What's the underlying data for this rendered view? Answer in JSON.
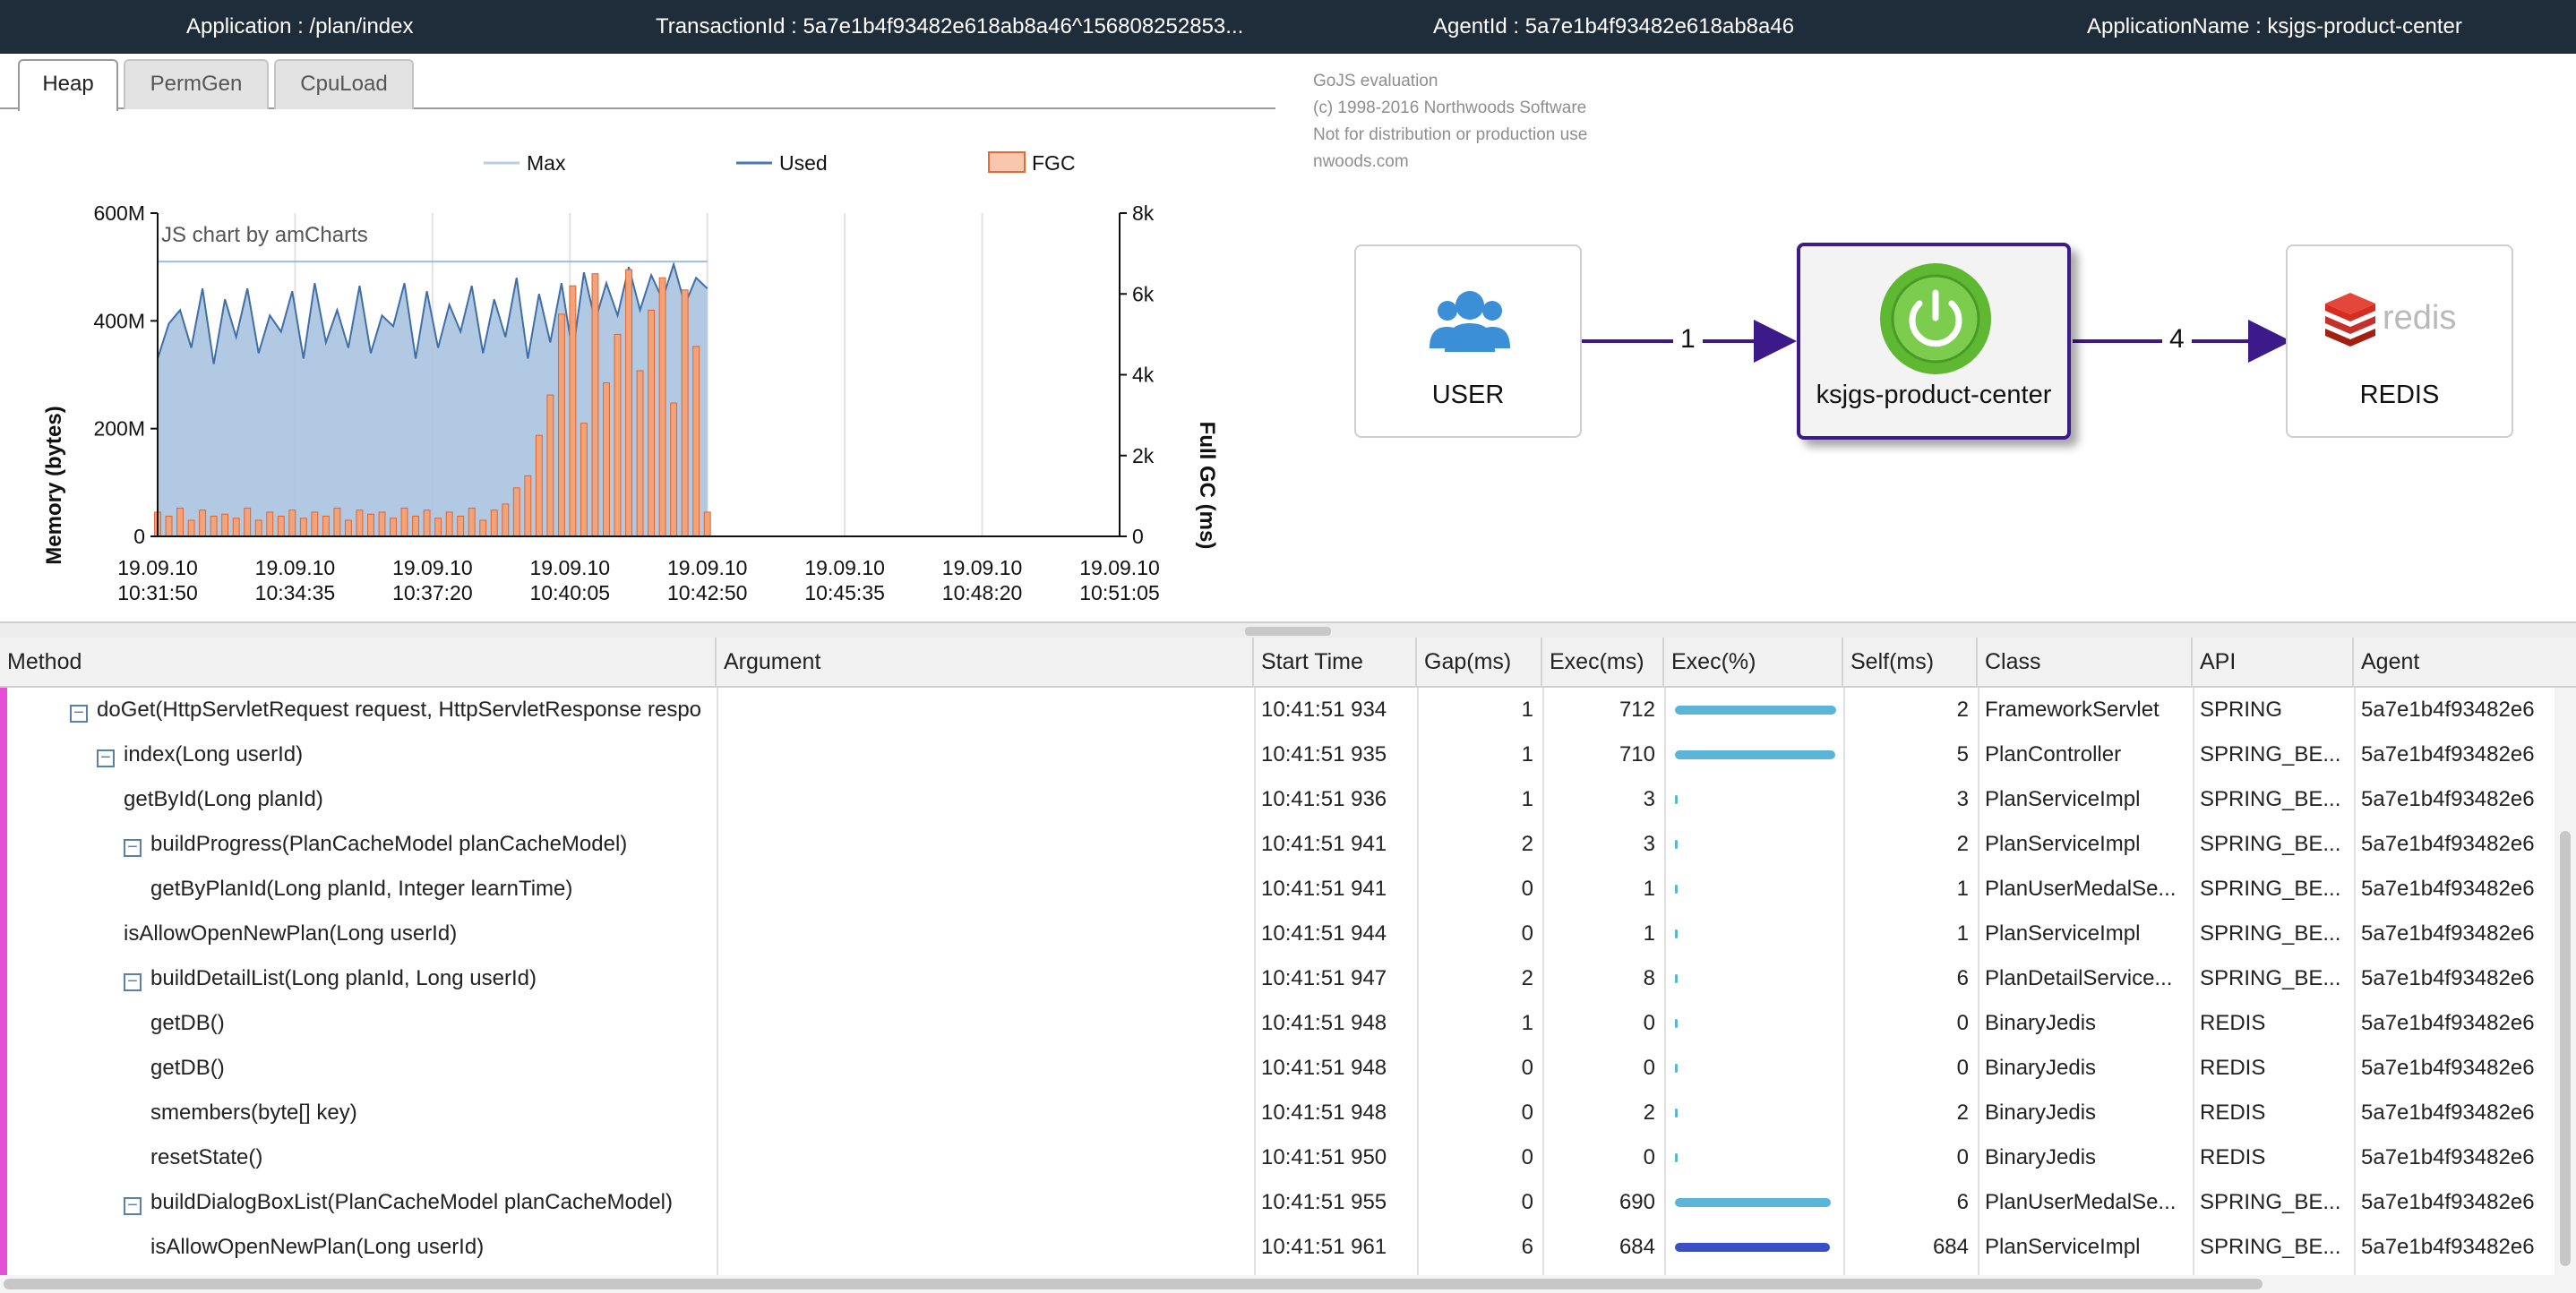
{
  "topbar": {
    "application": "Application : /plan/index",
    "transaction_id": "TransactionId : 5a7e1b4f93482e618ab8a46^156808252853...",
    "agent_id": "AgentId : 5a7e1b4f93482e618ab8a46",
    "application_name": "ApplicationName : ksjgs-product-center"
  },
  "tabs": [
    {
      "label": "Heap",
      "active": true
    },
    {
      "label": "PermGen",
      "active": false
    },
    {
      "label": "CpuLoad",
      "active": false
    }
  ],
  "chart_data": {
    "type": "area",
    "watermark": "JS chart by amCharts",
    "legend": [
      {
        "name": "Max",
        "color": "#b8cfe6",
        "kind": "line"
      },
      {
        "name": "Used",
        "color": "#4a7ab0",
        "kind": "line"
      },
      {
        "name": "FGC",
        "color": "#f8c7ad",
        "kind": "box"
      }
    ],
    "legend_position": "top",
    "ylabel_left": "Memory (bytes)",
    "ylabel_right": "Full GC (ms)",
    "y_left_ticks": [
      "0",
      "200M",
      "400M",
      "600M"
    ],
    "y_left_range_mb": [
      0,
      600
    ],
    "y_right_ticks": [
      "0",
      "2k",
      "4k",
      "6k",
      "8k"
    ],
    "y_right_range_ms": [
      0,
      8000
    ],
    "x_ticks": [
      {
        "date": "19.09.10",
        "time": "10:31:50"
      },
      {
        "date": "19.09.10",
        "time": "10:34:35"
      },
      {
        "date": "19.09.10",
        "time": "10:37:20"
      },
      {
        "date": "19.09.10",
        "time": "10:40:05"
      },
      {
        "date": "19.09.10",
        "time": "10:42:50"
      },
      {
        "date": "19.09.10",
        "time": "10:45:35"
      },
      {
        "date": "19.09.10",
        "time": "10:48:20"
      },
      {
        "date": "19.09.10",
        "time": "10:51:05"
      }
    ],
    "x_range": [
      "10:31:50",
      "10:51:05"
    ],
    "data_end": "10:42:50",
    "max_mb": 510,
    "grid": true,
    "series": [
      {
        "name": "Used",
        "unit": "MB",
        "values": [
          330,
          395,
          420,
          350,
          460,
          320,
          440,
          370,
          460,
          340,
          410,
          380,
          455,
          330,
          470,
          360,
          420,
          350,
          465,
          340,
          410,
          390,
          470,
          330,
          455,
          350,
          430,
          380,
          465,
          340,
          440,
          370,
          480,
          330,
          450,
          360,
          470,
          340,
          490,
          400,
          470,
          410,
          500,
          420,
          485,
          440,
          505,
          430,
          480,
          460
        ]
      },
      {
        "name": "FGC",
        "unit": "ms",
        "values": [
          600,
          500,
          700,
          400,
          650,
          500,
          550,
          450,
          700,
          400,
          600,
          500,
          650,
          450,
          600,
          500,
          700,
          400,
          650,
          550,
          600,
          450,
          700,
          500,
          650,
          450,
          600,
          500,
          700,
          400,
          650,
          800,
          1200,
          1500,
          2500,
          3500,
          5500,
          6200,
          2800,
          6500,
          3800,
          5000,
          6600,
          4100,
          5600,
          6400,
          3300,
          6100,
          4700,
          600
        ]
      }
    ]
  },
  "diagram": {
    "watermark": [
      "GoJS evaluation",
      "(c) 1998-2016 Northwoods Software",
      "Not for distribution or production use",
      "nwoods.com"
    ],
    "nodes": [
      {
        "label": "USER",
        "icon": "users-icon"
      },
      {
        "label": "ksjgs-product-center",
        "icon": "spring-power-icon"
      },
      {
        "label": "REDIS",
        "icon": "redis-logo"
      }
    ],
    "redis_logo_text": "redis",
    "links": [
      {
        "label": "1"
      },
      {
        "label": "4"
      }
    ]
  },
  "table": {
    "columns": [
      "Method",
      "Argument",
      "Start Time",
      "Gap(ms)",
      "Exec(ms)",
      "Exec(%)",
      "Self(ms)",
      "Class",
      "API",
      "Agent"
    ],
    "rows": [
      {
        "method": "doGet(HttpServletRequest request, HttpServletResponse respo",
        "level": 0,
        "toggle": true,
        "argument": "",
        "start": "10:41:51 934",
        "gap": "1",
        "exec": "712",
        "pct": 100,
        "self": "2",
        "class": "FrameworkServlet",
        "api": "SPRING",
        "agent": "5a7e1b4f93482e6",
        "bar_color": "#5bb5d9"
      },
      {
        "method": "index(Long userId)",
        "level": 1,
        "toggle": true,
        "argument": "",
        "start": "10:41:51 935",
        "gap": "1",
        "exec": "710",
        "pct": 99.7,
        "self": "5",
        "class": "PlanController",
        "api": "SPRING_BE...",
        "agent": "5a7e1b4f93482e6",
        "bar_color": "#5bb5d9"
      },
      {
        "method": "getById(Long planId)",
        "level": 2,
        "toggle": false,
        "argument": "",
        "start": "10:41:51 936",
        "gap": "1",
        "exec": "3",
        "pct": 0.4,
        "self": "3",
        "class": "PlanServiceImpl",
        "api": "SPRING_BE...",
        "agent": "5a7e1b4f93482e6",
        "bar_color": "#5bb5d9"
      },
      {
        "method": "buildProgress(PlanCacheModel planCacheModel)",
        "level": 2,
        "toggle": true,
        "argument": "",
        "start": "10:41:51 941",
        "gap": "2",
        "exec": "3",
        "pct": 0.4,
        "self": "2",
        "class": "PlanServiceImpl",
        "api": "SPRING_BE...",
        "agent": "5a7e1b4f93482e6",
        "bar_color": "#5bb5d9"
      },
      {
        "method": "getByPlanId(Long planId, Integer learnTime)",
        "level": 3,
        "toggle": false,
        "argument": "",
        "start": "10:41:51 941",
        "gap": "0",
        "exec": "1",
        "pct": 0.1,
        "self": "1",
        "class": "PlanUserMedalSe...",
        "api": "SPRING_BE...",
        "agent": "5a7e1b4f93482e6",
        "bar_color": "#5bb5d9"
      },
      {
        "method": "isAllowOpenNewPlan(Long userId)",
        "level": 2,
        "toggle": false,
        "argument": "",
        "start": "10:41:51 944",
        "gap": "0",
        "exec": "1",
        "pct": 0.1,
        "self": "1",
        "class": "PlanServiceImpl",
        "api": "SPRING_BE...",
        "agent": "5a7e1b4f93482e6",
        "bar_color": "#5bb5d9"
      },
      {
        "method": "buildDetailList(Long planId, Long userId)",
        "level": 2,
        "toggle": true,
        "argument": "",
        "start": "10:41:51 947",
        "gap": "2",
        "exec": "8",
        "pct": 1.1,
        "self": "6",
        "class": "PlanDetailService...",
        "api": "SPRING_BE...",
        "agent": "5a7e1b4f93482e6",
        "bar_color": "#5bb5d9"
      },
      {
        "method": "getDB()",
        "level": 3,
        "toggle": false,
        "argument": "",
        "start": "10:41:51 948",
        "gap": "1",
        "exec": "0",
        "pct": 0,
        "self": "0",
        "class": "BinaryJedis",
        "api": "REDIS",
        "agent": "5a7e1b4f93482e6",
        "bar_color": "#5bb5d9"
      },
      {
        "method": "getDB()",
        "level": 3,
        "toggle": false,
        "argument": "",
        "start": "10:41:51 948",
        "gap": "0",
        "exec": "0",
        "pct": 0,
        "self": "0",
        "class": "BinaryJedis",
        "api": "REDIS",
        "agent": "5a7e1b4f93482e6",
        "bar_color": "#5bb5d9"
      },
      {
        "method": "smembers(byte[] key)",
        "level": 3,
        "toggle": false,
        "argument": "",
        "start": "10:41:51 948",
        "gap": "0",
        "exec": "2",
        "pct": 0.3,
        "self": "2",
        "class": "BinaryJedis",
        "api": "REDIS",
        "agent": "5a7e1b4f93482e6",
        "bar_color": "#5bb5d9"
      },
      {
        "method": "resetState()",
        "level": 3,
        "toggle": false,
        "argument": "",
        "start": "10:41:51 950",
        "gap": "0",
        "exec": "0",
        "pct": 0,
        "self": "0",
        "class": "BinaryJedis",
        "api": "REDIS",
        "agent": "5a7e1b4f93482e6",
        "bar_color": "#5bb5d9"
      },
      {
        "method": "buildDialogBoxList(PlanCacheModel planCacheModel)",
        "level": 2,
        "toggle": true,
        "argument": "",
        "start": "10:41:51 955",
        "gap": "0",
        "exec": "690",
        "pct": 96.9,
        "self": "6",
        "class": "PlanUserMedalSe...",
        "api": "SPRING_BE...",
        "agent": "5a7e1b4f93482e6",
        "bar_color": "#5bb5d9"
      },
      {
        "method": "isAllowOpenNewPlan(Long userId)",
        "level": 3,
        "toggle": false,
        "argument": "",
        "start": "10:41:51 961",
        "gap": "6",
        "exec": "684",
        "pct": 96.1,
        "self": "684",
        "class": "PlanServiceImpl",
        "api": "SPRING_BE...",
        "agent": "5a7e1b4f93482e6",
        "bar_color": "#3a4fc7"
      }
    ]
  }
}
